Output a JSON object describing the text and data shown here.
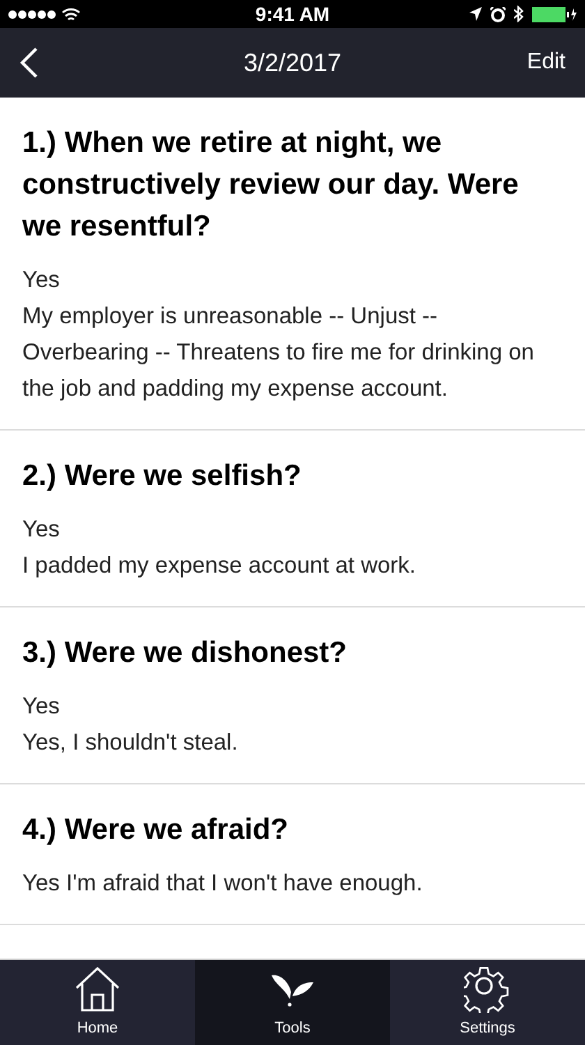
{
  "status_bar": {
    "time": "9:41 AM"
  },
  "nav_bar": {
    "title": "3/2/2017",
    "edit": "Edit"
  },
  "entries": [
    {
      "question": "1.) When we retire at night, we constructively review our day. Were we resentful?",
      "answer": [
        "Yes",
        "My employer is unreasonable -- Unjust -- Overbearing -- Threatens to fire me for drinking on the job and padding my expense account."
      ]
    },
    {
      "question": "2.) Were we selfish?",
      "answer": [
        "Yes",
        "I padded my expense account at work."
      ]
    },
    {
      "question": "3.) Were we dishonest?",
      "answer": [
        "Yes",
        "Yes, I shouldn't steal."
      ]
    },
    {
      "question": "4.) Were we afraid?",
      "answer": [
        "Yes I'm afraid that I won't have enough."
      ]
    }
  ],
  "tab_bar": [
    {
      "kind": "home",
      "label": "Home",
      "selected": false
    },
    {
      "kind": "tools",
      "label": "Tools",
      "selected": true
    },
    {
      "kind": "settings",
      "label": "Settings",
      "selected": false
    }
  ]
}
